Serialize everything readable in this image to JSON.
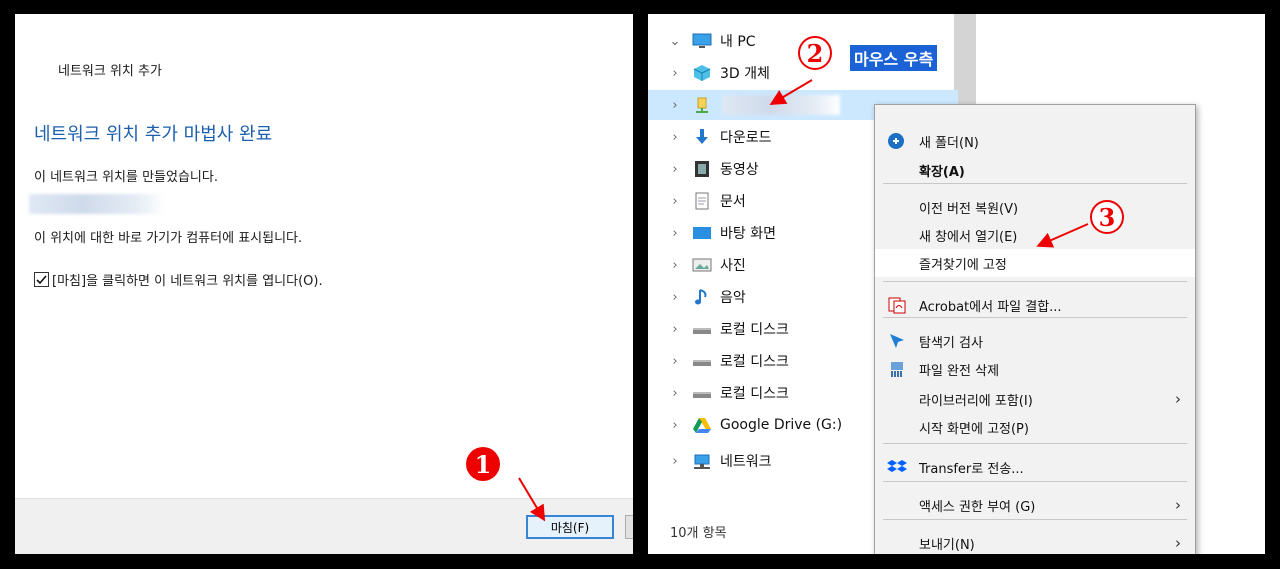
{
  "wizard": {
    "window_title": "네트워크 위치 추가",
    "heading": "네트워크 위치 추가 마법사 완료",
    "line_created": "이 네트워크 위치를 만들었습니다.",
    "line_shortcut": "이 위치에 대한 바로 가기가 컴퓨터에 표시됩니다.",
    "checkbox_label": "[마침]을 클릭하면 이 네트워크 위치를 엽니다(O).",
    "finish_button": "마침(F)"
  },
  "explorer": {
    "tree": [
      {
        "label": "내 PC",
        "icon": "monitor-icon",
        "expanded": true
      },
      {
        "label": "3D 개체",
        "icon": "cube-icon"
      },
      {
        "label": "",
        "icon": "network-drive-icon",
        "selected": true
      },
      {
        "label": "다운로드",
        "icon": "download-arrow-icon"
      },
      {
        "label": "동영상",
        "icon": "film-icon"
      },
      {
        "label": "문서",
        "icon": "document-icon"
      },
      {
        "label": "바탕 화면",
        "icon": "desktop-icon"
      },
      {
        "label": "사진",
        "icon": "picture-icon"
      },
      {
        "label": "음악",
        "icon": "music-note-icon"
      },
      {
        "label": "로컬 디스크",
        "icon": "disk-icon"
      },
      {
        "label": "로컬 디스크",
        "icon": "disk-icon"
      },
      {
        "label": "로컬 디스크",
        "icon": "disk-icon"
      },
      {
        "label": "Google Drive (G:)",
        "icon": "google-drive-icon"
      },
      {
        "label": "네트워크",
        "icon": "network-icon"
      }
    ],
    "status_text": "10개 항목"
  },
  "context_menu": {
    "items": [
      {
        "label": "새 폴더(N)",
        "icon": "new-folder-icon"
      },
      {
        "label": "확장(A)",
        "bold": true
      },
      {
        "label": "이전 버전 복원(V)"
      },
      {
        "label": "새 창에서 열기(E)"
      },
      {
        "label": "즐겨찾기에 고정",
        "highlight": true
      },
      {
        "label": "Acrobat에서 파일 결합...",
        "icon": "acrobat-icon"
      },
      {
        "label": "탐색기 검사",
        "icon": "scan-icon"
      },
      {
        "label": "파일 완전 삭제",
        "icon": "shred-icon"
      },
      {
        "label": "라이브러리에 포함(I)",
        "submenu": true
      },
      {
        "label": "시작 화면에 고정(P)"
      },
      {
        "label": "Transfer로 전송...",
        "icon": "dropbox-icon"
      },
      {
        "label": "액세스 권한 부여 (G)",
        "submenu": true
      },
      {
        "label": "보내기(N)",
        "submenu": true
      }
    ]
  },
  "annotations": {
    "step1": "1",
    "step2": "2",
    "step3": "3",
    "step2_label": "마우스 우측"
  },
  "colors": {
    "accent_blue": "#1b5fae",
    "annotation_red": "#e00000",
    "selection": "#cce8ff"
  }
}
